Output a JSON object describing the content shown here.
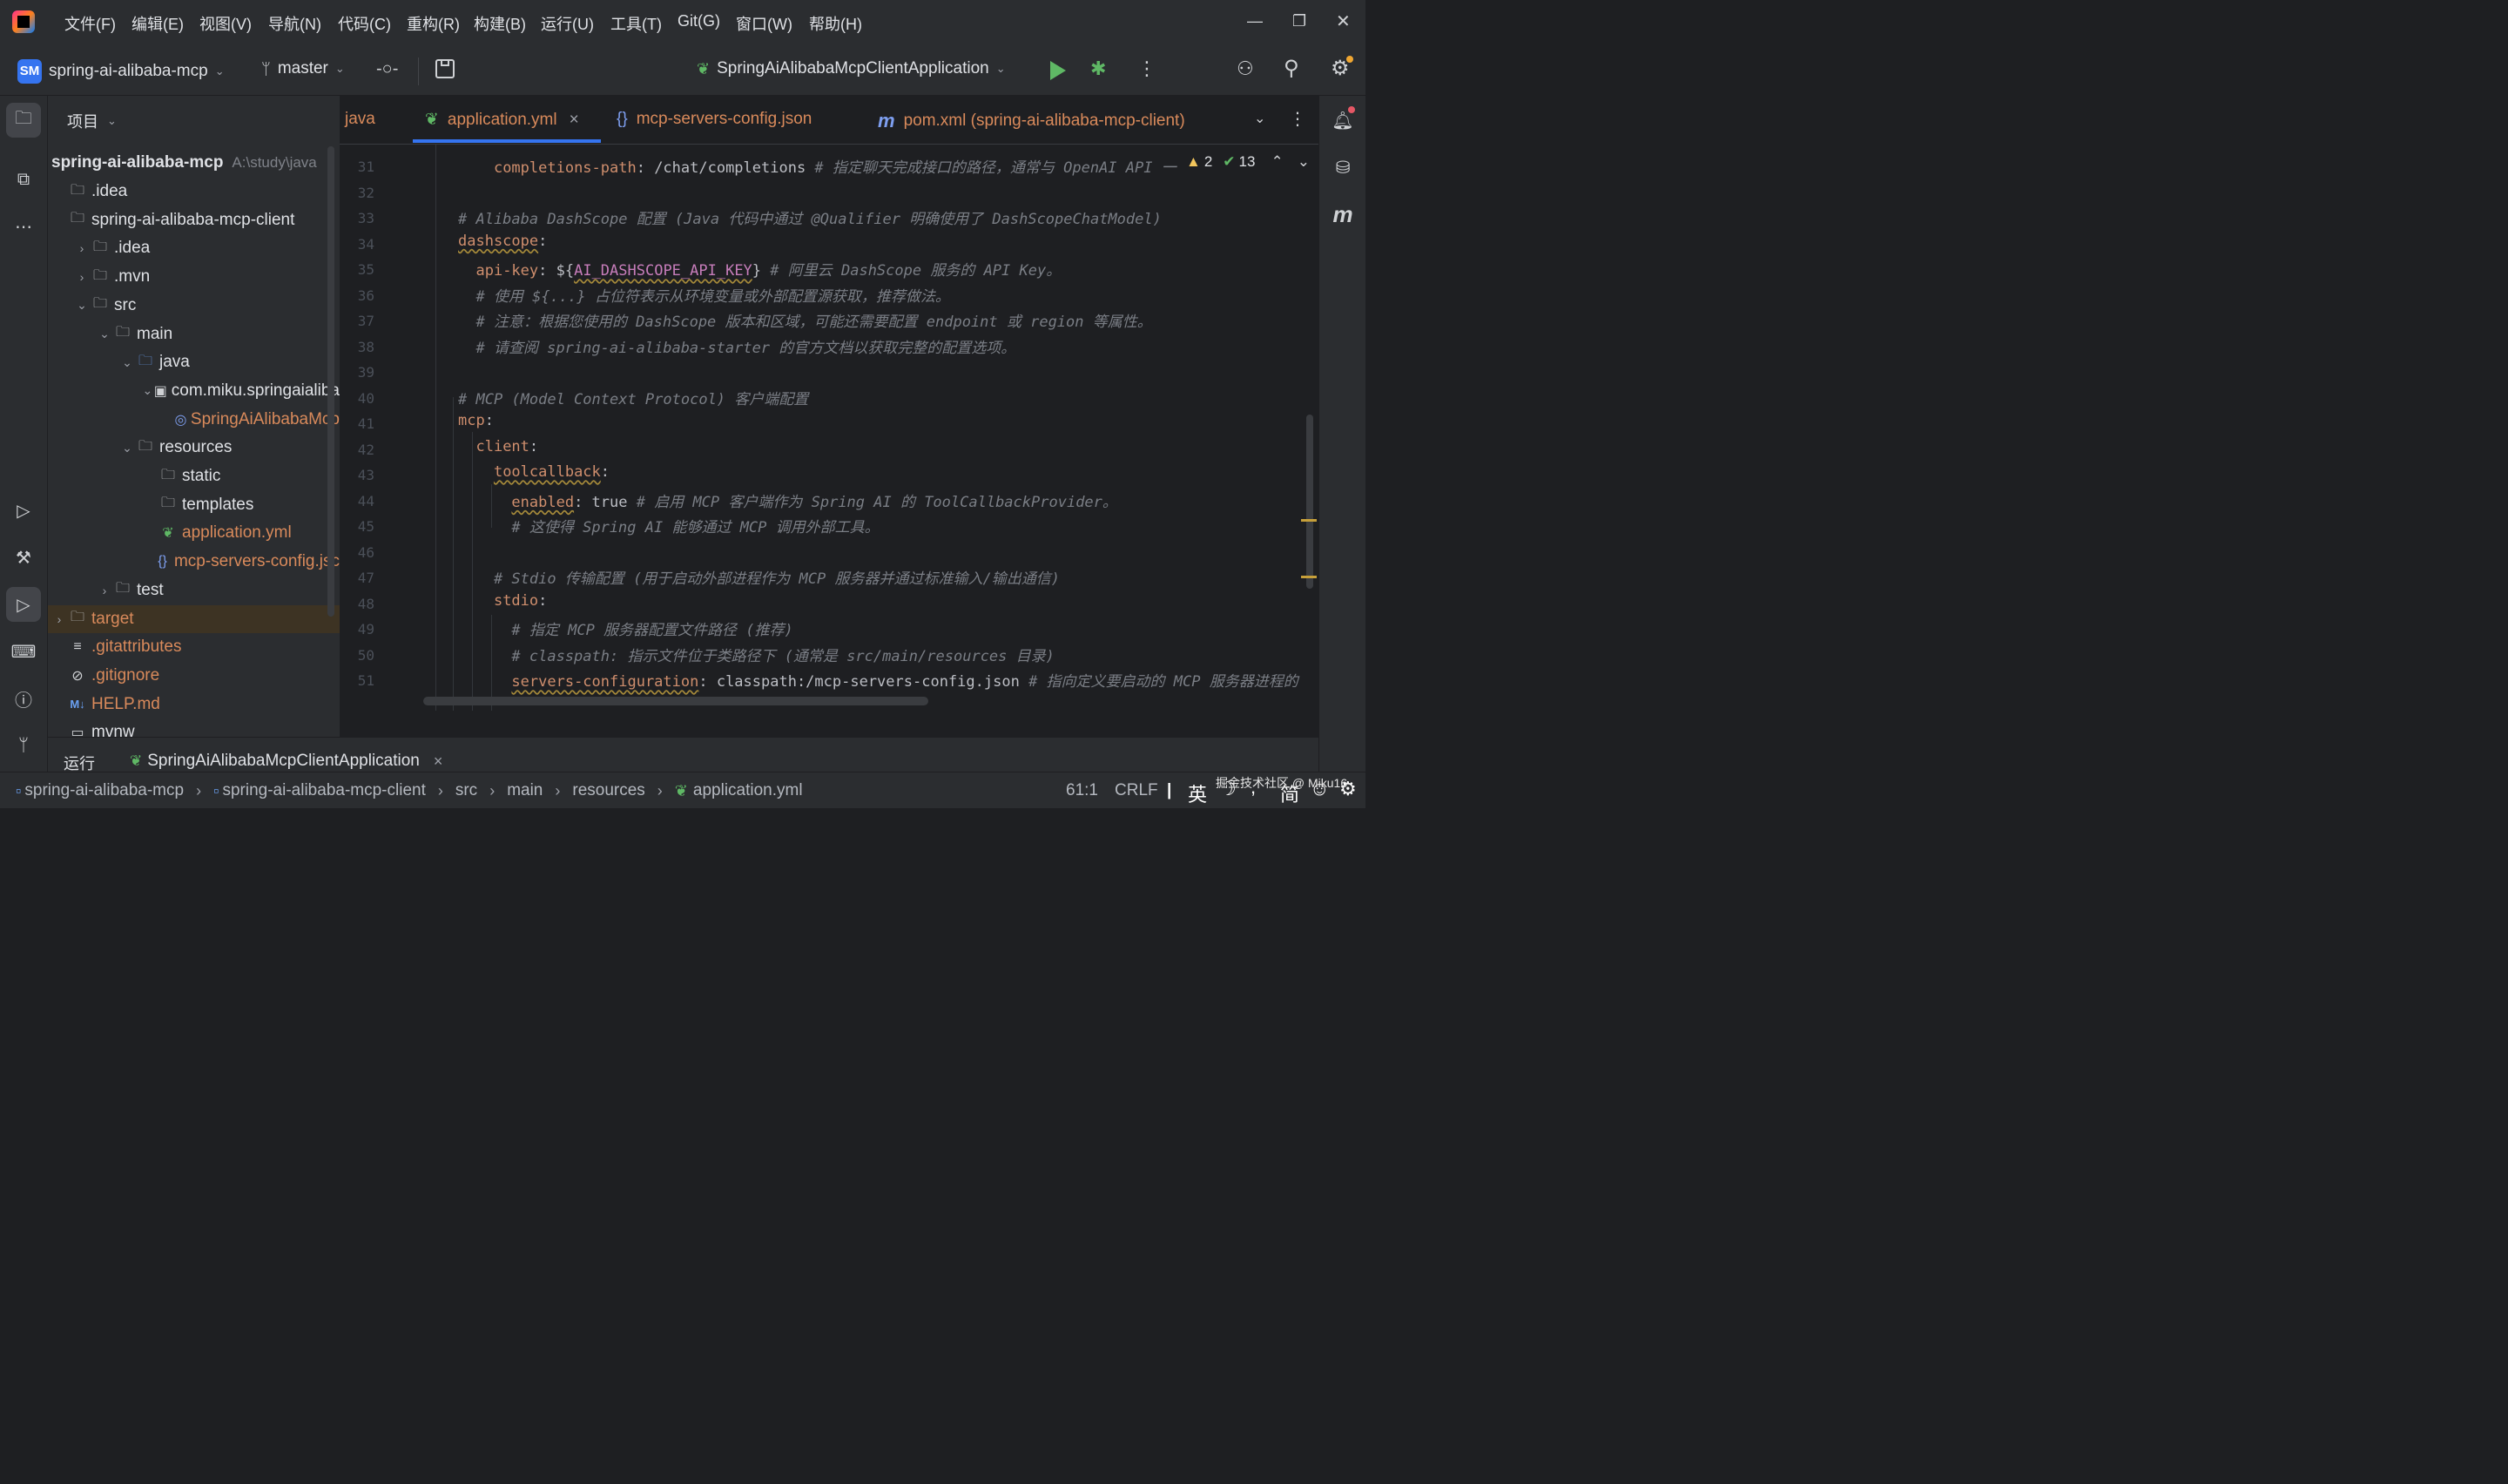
{
  "menu": [
    "文件(F)",
    "编辑(E)",
    "视图(V)",
    "导航(N)",
    "代码(C)",
    "重构(R)",
    "构建(B)",
    "运行(U)",
    "工具(T)",
    "Git(G)",
    "窗口(W)",
    "帮助(H)"
  ],
  "toolbar": {
    "project_badge": "SM",
    "project_name": "spring-ai-alibaba-mcp",
    "branch": "master",
    "run_config": "SpringAiAlibabaMcpClientApplication"
  },
  "project_pane": {
    "title": "项目",
    "root_name": "spring-ai-alibaba-mcp",
    "root_path": "A:\\study\\java",
    "tree": [
      {
        "label": ".idea",
        "indent": 0,
        "chev": "",
        "icon": "folder"
      },
      {
        "label": "spring-ai-alibaba-mcp-client",
        "indent": 0,
        "chev": "",
        "icon": "module",
        "bold": true
      },
      {
        "label": ".idea",
        "indent": 1,
        "chev": "›",
        "icon": "folder"
      },
      {
        "label": ".mvn",
        "indent": 1,
        "chev": "›",
        "icon": "folder"
      },
      {
        "label": "src",
        "indent": 1,
        "chev": "⌄",
        "icon": "folder"
      },
      {
        "label": "main",
        "indent": 2,
        "chev": "⌄",
        "icon": "folder"
      },
      {
        "label": "java",
        "indent": 3,
        "chev": "⌄",
        "icon": "folder-blue"
      },
      {
        "label": "com.miku.springaialiba",
        "indent": 4,
        "chev": "⌄",
        "icon": "package"
      },
      {
        "label": "SpringAiAlibabaMcp",
        "indent": 5,
        "chev": "",
        "icon": "spring",
        "orange": true
      },
      {
        "label": "resources",
        "indent": 3,
        "chev": "⌄",
        "icon": "folder-res"
      },
      {
        "label": "static",
        "indent": 4,
        "chev": "",
        "icon": "folder"
      },
      {
        "label": "templates",
        "indent": 4,
        "chev": "",
        "icon": "folder"
      },
      {
        "label": "application.yml",
        "indent": 4,
        "chev": "",
        "icon": "yml",
        "orange": true
      },
      {
        "label": "mcp-servers-config.jsc",
        "indent": 4,
        "chev": "",
        "icon": "json",
        "orange": true
      },
      {
        "label": "test",
        "indent": 2,
        "chev": "›",
        "icon": "folder"
      },
      {
        "label": "target",
        "indent": 0,
        "chev": "›",
        "icon": "folder-orange",
        "orange": true,
        "highlight": true
      },
      {
        "label": ".gitattributes",
        "indent": 0,
        "chev": "",
        "icon": "lines",
        "orange": true
      },
      {
        "label": ".gitignore",
        "indent": 0,
        "chev": "",
        "icon": "ignore",
        "orange": true
      },
      {
        "label": "HELP.md",
        "indent": 0,
        "chev": "",
        "icon": "md",
        "orange": true
      },
      {
        "label": "mvnw",
        "indent": 0,
        "chev": "",
        "icon": "file"
      }
    ]
  },
  "tabs": [
    {
      "label": "java",
      "icon": ""
    },
    {
      "label": "application.yml",
      "icon": "yml",
      "active": true,
      "close": "×"
    },
    {
      "label": "mcp-servers-config.json",
      "icon": "{}"
    },
    {
      "label": "pom.xml (spring-ai-alibaba-mcp-client)",
      "icon": "m"
    }
  ],
  "inspections": {
    "warnings": "2",
    "ok": "13"
  },
  "code_lines": [
    {
      "n": "31",
      "parts": [
        [
          "    ",
          "v"
        ],
        [
          "completions-path",
          "k"
        ],
        [
          ": /chat/completions ",
          "v"
        ],
        [
          "# 指定聊天完成接口的路径，通常与 OpenAI API 一",
          "c"
        ]
      ]
    },
    {
      "n": "32",
      "parts": []
    },
    {
      "n": "33",
      "parts": [
        [
          "# Alibaba DashScope 配置 (Java 代码中通过 @Qualifier 明确使用了 DashScopeChatModel)",
          "c"
        ]
      ]
    },
    {
      "n": "34",
      "parts": [
        [
          "dashscope",
          "k u"
        ],
        [
          ":",
          "v"
        ]
      ]
    },
    {
      "n": "35",
      "parts": [
        [
          "  ",
          "v"
        ],
        [
          "api-key",
          "k"
        ],
        [
          ": ${",
          "v"
        ],
        [
          "AI_DASHSCOPE_API_KEY",
          "ph"
        ],
        [
          "} ",
          "v"
        ],
        [
          "# 阿里云 DashScope 服务的 API Key。",
          "c"
        ]
      ]
    },
    {
      "n": "36",
      "parts": [
        [
          "  # 使用 ${...} 占位符表示从环境变量或外部配置源获取，推荐做法。",
          "c"
        ]
      ]
    },
    {
      "n": "37",
      "parts": [
        [
          "  # 注意：根据您使用的 DashScope 版本和区域，可能还需要配置 endpoint 或 region 等属性。",
          "c"
        ]
      ]
    },
    {
      "n": "38",
      "parts": [
        [
          "  # 请查阅 spring-ai-alibaba-starter 的官方文档以获取完整的配置选项。",
          "c"
        ]
      ]
    },
    {
      "n": "39",
      "parts": []
    },
    {
      "n": "40",
      "parts": [
        [
          "# MCP (Model Context Protocol) 客户端配置",
          "c"
        ]
      ]
    },
    {
      "n": "41",
      "parts": [
        [
          "mcp",
          "k"
        ],
        [
          ":",
          "v"
        ]
      ]
    },
    {
      "n": "42",
      "parts": [
        [
          "  ",
          "v"
        ],
        [
          "client",
          "k"
        ],
        [
          ":",
          "v"
        ]
      ]
    },
    {
      "n": "43",
      "parts": [
        [
          "    ",
          "v"
        ],
        [
          "toolcallback",
          "k u"
        ],
        [
          ":",
          "v"
        ]
      ]
    },
    {
      "n": "44",
      "parts": [
        [
          "      ",
          "v"
        ],
        [
          "enabled",
          "k u"
        ],
        [
          ": true ",
          "v"
        ],
        [
          "# 启用 MCP 客户端作为 Spring AI 的 ToolCallbackProvider。",
          "c"
        ]
      ]
    },
    {
      "n": "45",
      "parts": [
        [
          "      # 这使得 Spring AI 能够通过 MCP 调用外部工具。",
          "c"
        ]
      ]
    },
    {
      "n": "46",
      "parts": []
    },
    {
      "n": "47",
      "parts": [
        [
          "    # Stdio 传输配置 (用于启动外部进程作为 MCP 服务器并通过标准输入/输出通信)",
          "c"
        ]
      ]
    },
    {
      "n": "48",
      "parts": [
        [
          "    ",
          "v"
        ],
        [
          "stdio",
          "k"
        ],
        [
          ":",
          "v"
        ]
      ]
    },
    {
      "n": "49",
      "parts": [
        [
          "      # 指定 MCP 服务器配置文件路径 (推荐)",
          "c"
        ]
      ]
    },
    {
      "n": "50",
      "parts": [
        [
          "      # classpath: 指示文件位于类路径下 (通常是 src/main/resources 目录)",
          "c"
        ]
      ]
    },
    {
      "n": "51",
      "parts": [
        [
          "      ",
          "v"
        ],
        [
          "servers-configuration",
          "k u"
        ],
        [
          ": classpath:/mcp-servers-config.json ",
          "v"
        ],
        [
          "# 指向定义要启动的 MCP 服务器进程的",
          "c"
        ]
      ]
    }
  ],
  "runbar": {
    "title": "运行",
    "config": "SpringAiAlibabaMcpClientApplication",
    "close": "×"
  },
  "statusbar": {
    "crumbs": [
      "spring-ai-alibaba-mcp",
      "spring-ai-alibaba-mcp-client",
      "src",
      "main",
      "resources",
      "application.yml"
    ],
    "position": "61:1",
    "line_sep": "CRLF",
    "ime_lang": "英",
    "ime_mode": "简",
    "watermark": "掘金技术社区 @ Miku16"
  },
  "colors": {
    "accent": "#3574f0",
    "orange": "#d98a5b",
    "key": "#cf8e6d",
    "comment": "#7a7e85",
    "run_green": "#5fb865"
  }
}
